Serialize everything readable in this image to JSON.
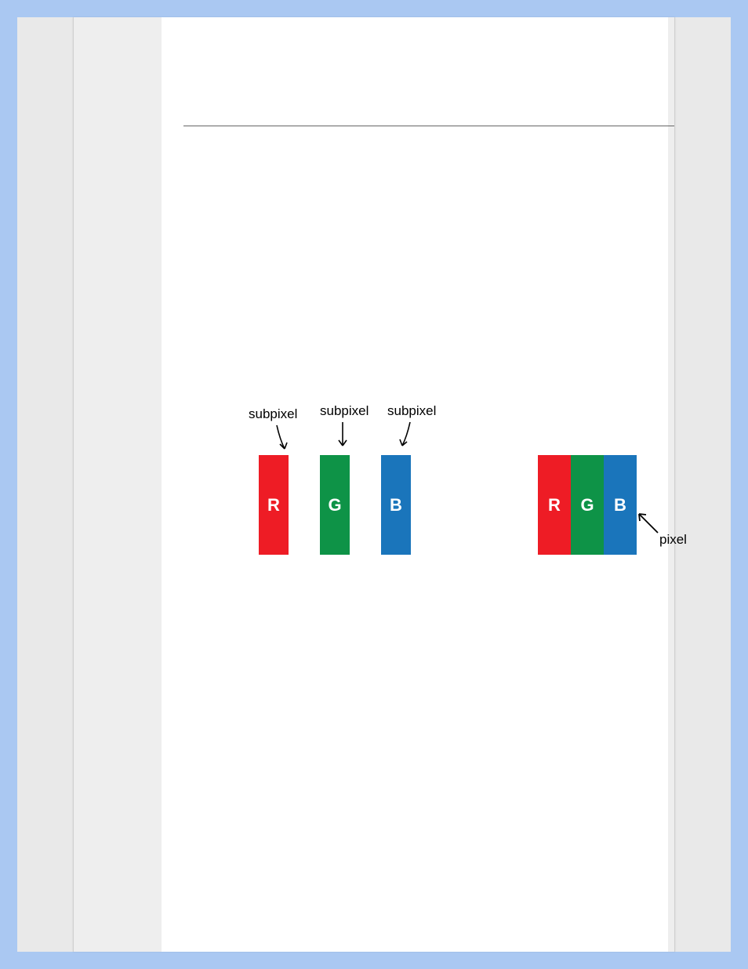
{
  "diagram": {
    "subpixels": [
      {
        "label": "subpixel",
        "letter": "R",
        "color": "#ee1c25"
      },
      {
        "label": "subpixel",
        "letter": "G",
        "color": "#0e9347"
      },
      {
        "label": "subpixel",
        "letter": "B",
        "color": "#1a75bb"
      }
    ],
    "pixel": {
      "label": "pixel",
      "blocks": [
        {
          "letter": "R",
          "color": "#ee1c25"
        },
        {
          "letter": "G",
          "color": "#0e9347"
        },
        {
          "letter": "B",
          "color": "#1a75bb"
        }
      ]
    }
  }
}
